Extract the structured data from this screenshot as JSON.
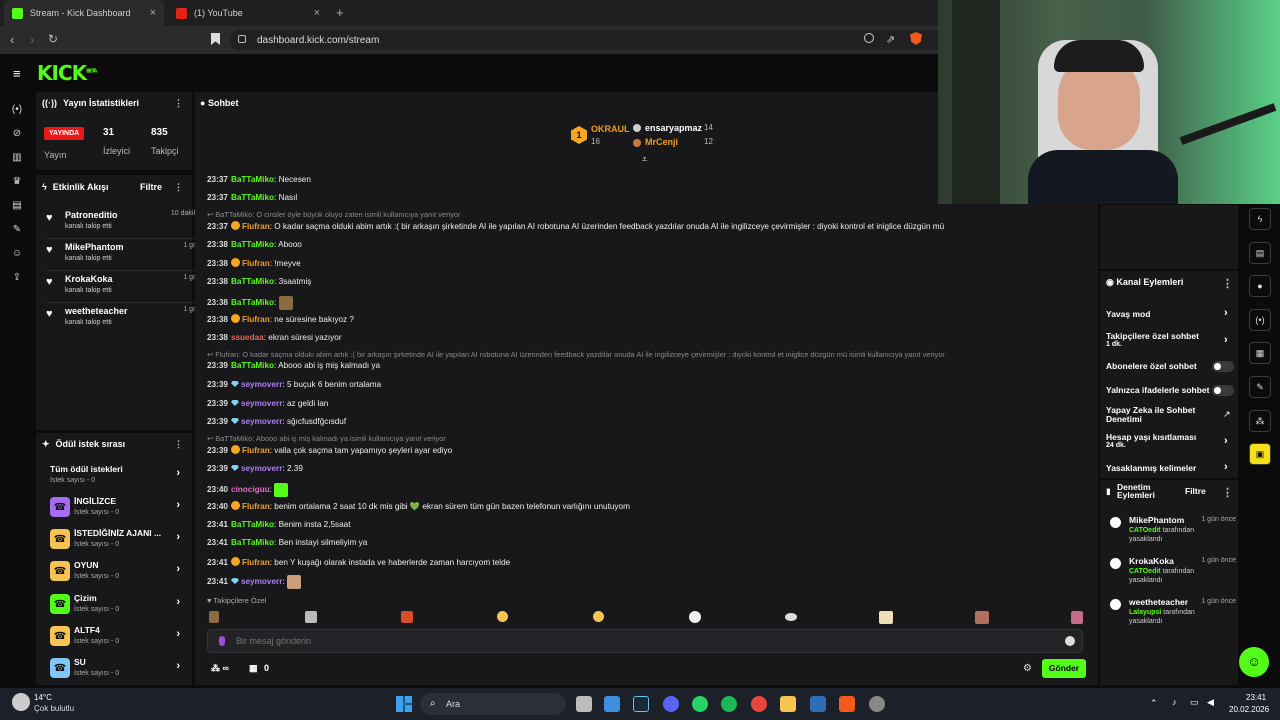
{
  "browser": {
    "tabs": [
      {
        "title": "Stream - Kick Dashboard"
      },
      {
        "title": "(1) YouTube"
      }
    ],
    "url": "dashboard.kick.com/stream",
    "new_tab": "+"
  },
  "logo": "KICK",
  "logo_beta": "BETA",
  "stats": {
    "title": "Yayın İstatistikleri",
    "live_badge": "YAYINDA",
    "live_label": "Yayın",
    "viewers": "31",
    "viewers_label": "İzleyici",
    "followers": "835",
    "followers_label": "Takipçi"
  },
  "activity": {
    "title": "Etkinlik Akışı",
    "filter": "Filtre",
    "items": [
      {
        "name": "Patroneditio",
        "time": "10 dakika önce",
        "sub": "kanalı takip etti"
      },
      {
        "name": "MikePhantom",
        "time": "1 gün önce",
        "sub": "kanalı takip etti"
      },
      {
        "name": "KrokaKoka",
        "time": "1 gün önce",
        "sub": "kanalı takip etti"
      },
      {
        "name": "weetheteacher",
        "time": "1 gün önce",
        "sub": "kanalı takip etti"
      }
    ]
  },
  "rewards": {
    "title": "Ödül istek sırası",
    "items": [
      {
        "title": "Tüm ödül istekleri",
        "sub": "İstek sayısı - 0",
        "color": ""
      },
      {
        "title": "İNGİLİZCE",
        "sub": "İstek sayısı - 0",
        "color": "#a66df0"
      },
      {
        "title": "İSTEDİĞİNİZ AJANI ...",
        "sub": "İstek sayısı - 0",
        "color": "#f5c451"
      },
      {
        "title": "OYUN",
        "sub": "İstek sayısı - 0",
        "color": "#f5c451"
      },
      {
        "title": "Çizim",
        "sub": "İstek sayısı - 0",
        "color": "#53fc18"
      },
      {
        "title": "ALTF4",
        "sub": "İstek sayısı - 0",
        "color": "#f5c451"
      },
      {
        "title": "SU",
        "sub": "İstek sayısı - 0",
        "color": "#7fc8f5"
      }
    ]
  },
  "chat": {
    "title": "Sohbet",
    "leaderboard": {
      "first": {
        "rank": "1",
        "name": "OKRAUL",
        "count": "16"
      },
      "second": {
        "name": "ensaryapmaz",
        "count": "14"
      },
      "third": {
        "name": "MrCenji",
        "count": "12"
      }
    },
    "followers_only": "Takipçilere Özel",
    "placeholder": "Bir mesaj gönderin",
    "infinity": "∞",
    "bag_count": "0",
    "send": "Gönder",
    "messages": [
      {
        "kind": "msg",
        "time": "23:37",
        "user": "BaTTaMiko",
        "color": "g",
        "badge": "",
        "text": "Necesen"
      },
      {
        "kind": "msg",
        "time": "23:37",
        "user": "BaTTaMiko",
        "color": "g",
        "badge": "",
        "text": "Nasıl"
      },
      {
        "kind": "reply",
        "text": "BaTTaMiko: O cinsler öyle büyük oluyo zaten isimli kullanıcıya yanıt veriyor"
      },
      {
        "kind": "msg",
        "time": "23:37",
        "user": "Flufran",
        "color": "o",
        "badge": "coin",
        "text": "O kadar saçma olduki abim artık :( bir arkaşın şirketinde AI ile yapılan AI robotuna AI üzerinden feedback yazdılar onuda AI ile ingilizceye çevirmişler : diyoki kontrol et iniglice düzgün mü"
      },
      {
        "kind": "msg",
        "time": "23:38",
        "user": "BaTTaMiko",
        "color": "g",
        "badge": "",
        "text": "Abooo"
      },
      {
        "kind": "msg",
        "time": "23:38",
        "user": "Flufran",
        "color": "o",
        "badge": "coin",
        "text": "!meyve"
      },
      {
        "kind": "msg",
        "time": "23:38",
        "user": "BaTTaMiko",
        "color": "g",
        "badge": "",
        "text": "3saatmiş"
      },
      {
        "kind": "msg",
        "time": "23:38",
        "user": "BaTTaMiko",
        "color": "g",
        "badge": "",
        "text": ""
      },
      {
        "kind": "msg",
        "time": "23:38",
        "user": "Flufran",
        "color": "o",
        "badge": "coin",
        "text": "ne süresine bakıyoz ?"
      },
      {
        "kind": "msg",
        "time": "23:38",
        "user": "ssuedaa",
        "color": "r",
        "badge": "",
        "text": "ekran süresi yazıyor"
      },
      {
        "kind": "reply",
        "text": "Flufran: O kadar saçma olduki abim artık :( bir arkaşın şirketinde AI ile yapılan AI robotuna AI üzerinden feedback yazdılar onuda AI ile ingilizceye çevirmişler : diyoki kontrol et iniglice düzgün mü isimli kullanıcıya yanıt veriyor"
      },
      {
        "kind": "msg",
        "time": "23:39",
        "user": "BaTTaMiko",
        "color": "g",
        "badge": "",
        "text": "Abooo abi iş miş kalmadı ya"
      },
      {
        "kind": "msg",
        "time": "23:39",
        "user": "seymoverr",
        "color": "p",
        "badge": "dia",
        "text": "5 buçuk 6 benim ortalama"
      },
      {
        "kind": "msg",
        "time": "23:39",
        "user": "seymoverr",
        "color": "p",
        "badge": "dia",
        "text": "az geldi lan"
      },
      {
        "kind": "msg",
        "time": "23:39",
        "user": "seymoverr",
        "color": "p",
        "badge": "dia",
        "text": "sğıcfusdfğcısduf"
      },
      {
        "kind": "reply",
        "text": "BaTTaMiko: Abooo abi iş miş kalmadı ya isimli kullanıcıya yanıt veriyor"
      },
      {
        "kind": "msg",
        "time": "23:39",
        "user": "Flufran",
        "color": "o",
        "badge": "coin",
        "text": "valla çok saçma tam yapamıyo şeyleri ayar ediyo"
      },
      {
        "kind": "msg",
        "time": "23:39",
        "user": "seymoverr",
        "color": "p",
        "badge": "dia",
        "text": "2.39"
      },
      {
        "kind": "msg",
        "time": "23:40",
        "user": "cinociguu",
        "color": "pk",
        "badge": "",
        "text": ""
      },
      {
        "kind": "msg",
        "time": "23:40",
        "user": "Flufran",
        "color": "o",
        "badge": "coin",
        "text": "benim ortalama 2 saat 10 dk mis gibi 💚 ekran sürem tüm gün bazen telefonun varlığını unutuyom"
      },
      {
        "kind": "msg",
        "time": "23:41",
        "user": "BaTTaMiko",
        "color": "g",
        "badge": "",
        "text": "Benim insta 2,5saat"
      },
      {
        "kind": "msg",
        "time": "23:41",
        "user": "BaTTaMiko",
        "color": "g",
        "badge": "",
        "text": "Ben instayi silmeliyim ya"
      },
      {
        "kind": "msg",
        "time": "23:41",
        "user": "Flufran",
        "color": "o",
        "badge": "coin",
        "text": "ben Y kuşağı olarak instada ve haberlerde zaman harcıyom telde"
      },
      {
        "kind": "msg",
        "time": "23:41",
        "user": "seymoverr",
        "color": "p",
        "badge": "dia",
        "text": ""
      }
    ]
  },
  "channel_actions": {
    "title": "Kanal Eylemleri",
    "slow_mode": "Yavaş mod",
    "followers_chat": "Takipçilere özel sohbet",
    "followers_chat_val": "1 dk.",
    "subs_chat": "Abonelere özel sohbet",
    "emotes_chat": "Yalnızca ifadelerle sohbet",
    "ai_mod": "Yapay Zeka ile Sohbet Denetimi",
    "age_limit": "Hesap yaşı kısıtlaması",
    "age_limit_val": "24 dk.",
    "banned": "Yasaklanmış kelimeler"
  },
  "moderation": {
    "title": "Denetim Eylemleri",
    "filter": "Filtre",
    "items": [
      {
        "name": "MikePhantom",
        "time": "1 gün önce",
        "by": "CATOedit",
        "l2": "tarafından",
        "l3": "yasaklandı"
      },
      {
        "name": "KrokaKoka",
        "time": "1 gün önce",
        "by": "CATOedit",
        "l2": "tarafından",
        "l3": "yasaklandı"
      },
      {
        "name": "weetheteacher",
        "time": "1 gün önce",
        "by": "Lalayupsi",
        "l2": "tarafından",
        "l3": "yasaklandı"
      }
    ]
  },
  "taskbar": {
    "temp": "14°C",
    "weather": "Çok bulutlu",
    "search": "Ara",
    "time": "23:41",
    "date": "20.02.2026"
  },
  "colors": {
    "accent": "#53fc18",
    "live": "#e91916"
  }
}
